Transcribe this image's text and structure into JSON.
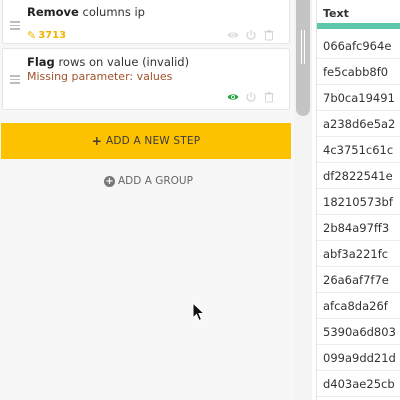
{
  "steps": [
    {
      "name_bold": "Remove",
      "name_rest": " columns ip",
      "badge_value": "3713",
      "subtitle": ""
    },
    {
      "name_bold": "Flag",
      "name_rest": " rows on value (invalid)",
      "subtitle": "Missing parameter: values",
      "badge_value": ""
    }
  ],
  "add_step_label": "ADD A NEW STEP",
  "add_step_icon": "+",
  "add_group_label": "ADD A GROUP",
  "add_group_icon": "+",
  "icons": {
    "eye": "eye-icon",
    "power": "power-icon",
    "trash": "trash-icon",
    "pencil": "pencil-icon"
  },
  "colors": {
    "accent_yellow": "#fcc200",
    "eye_active": "#27a844",
    "eye_inactive": "#d6d6d6",
    "header_bar": "#5ec6aa",
    "error_text": "#a0522d"
  },
  "table": {
    "column_name": "Text",
    "rows": [
      "066afc964e",
      "fe5cabb8f0",
      "7b0ca19491",
      "a238d6e5a2",
      "4c3751c61c",
      "df2822541e",
      "18210573bf",
      "2b84a97ff3",
      "abf3a221fc",
      "26a6af7f7e",
      "afca8da26f",
      "5390a6d803",
      "099a9dd21d",
      "d403ae25cb"
    ]
  }
}
